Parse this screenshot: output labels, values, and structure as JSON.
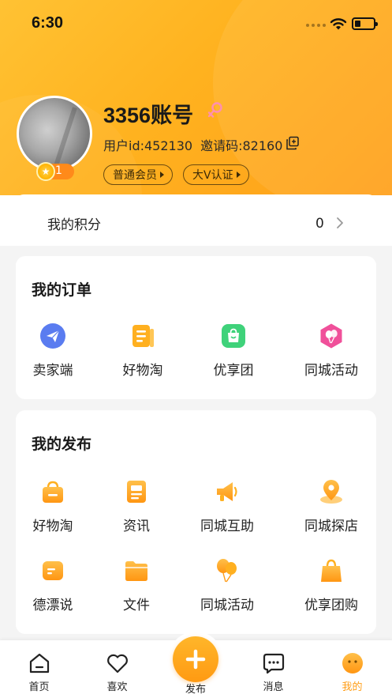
{
  "status_bar": {
    "time": "6:30"
  },
  "profile": {
    "username": "3356账号",
    "user_id": "用户id:452130",
    "invite_code": "邀请码:82160",
    "level": "1",
    "tags": [
      "普通会员",
      "大V认证"
    ]
  },
  "points": {
    "label": "我的积分",
    "value": "0"
  },
  "orders": {
    "title": "我的订单",
    "items": [
      {
        "label": "卖家端",
        "icon": "send-icon",
        "color": "#5a7cf0"
      },
      {
        "label": "好物淘",
        "icon": "document-icon",
        "color": "#ffb020"
      },
      {
        "label": "优享团",
        "icon": "shopping-bag-icon",
        "color": "#3fd27a"
      },
      {
        "label": "同城活动",
        "icon": "balloon-icon",
        "color": "#f0509a"
      }
    ]
  },
  "publish": {
    "title": "我的发布",
    "items": [
      {
        "label": "好物淘",
        "icon": "basket-icon"
      },
      {
        "label": "资讯",
        "icon": "news-icon"
      },
      {
        "label": "同城互助",
        "icon": "megaphone-icon"
      },
      {
        "label": "同城探店",
        "icon": "location-pin-icon"
      },
      {
        "label": "德漂说",
        "icon": "chat-bubble-icon"
      },
      {
        "label": "文件",
        "icon": "folder-icon"
      },
      {
        "label": "同城活动",
        "icon": "balloon-icon"
      },
      {
        "label": "优享团购",
        "icon": "shopping-bag-icon"
      }
    ]
  },
  "tabbar": {
    "items": [
      {
        "label": "首页",
        "icon": "home-icon"
      },
      {
        "label": "喜欢",
        "icon": "heart-icon"
      },
      {
        "label": "发布",
        "icon": "plus-icon"
      },
      {
        "label": "消息",
        "icon": "message-icon"
      },
      {
        "label": "我的",
        "icon": "face-icon"
      }
    ],
    "active": "我的"
  },
  "colors": {
    "accent": "#ff9f1a",
    "header": "#ffb21f"
  }
}
